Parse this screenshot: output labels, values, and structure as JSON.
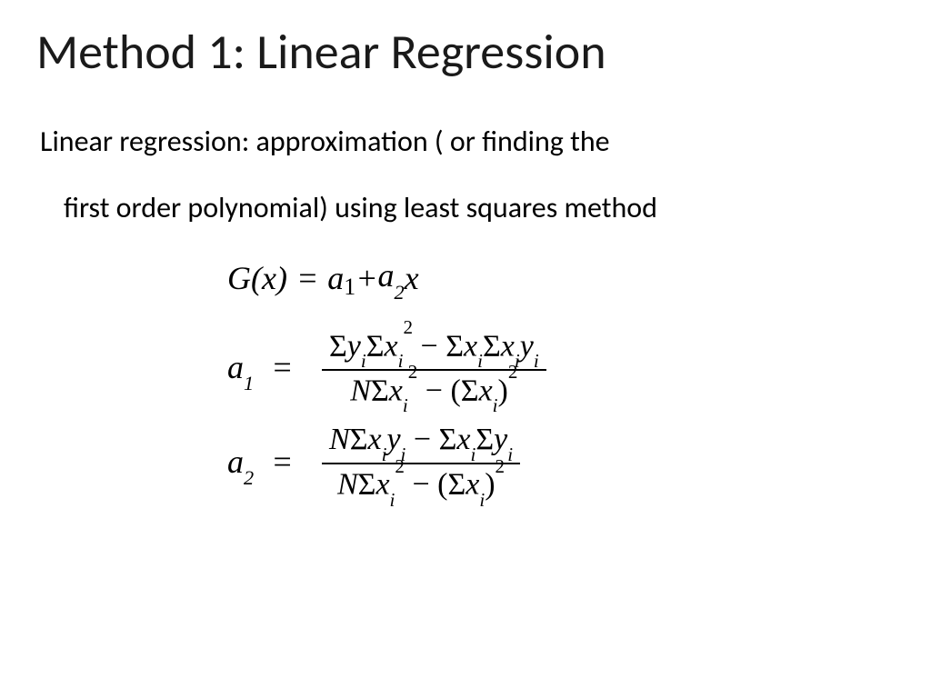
{
  "title": "Method 1: Linear Regression",
  "body": {
    "line1": "Linear regression: approximation ( or finding the",
    "line2": "first order polynomial) using least squares method"
  },
  "equations": {
    "model": {
      "lhs": "G(x)",
      "eq": "=",
      "rhs_a1": "a",
      "rhs_a1_sub": "1",
      "plus": " + ",
      "rhs_a2": "a",
      "rhs_a2_sub": "2",
      "rhs_x": "x"
    },
    "a1": {
      "lhs_var": "a",
      "lhs_sub": "1",
      "eq": "=",
      "num": "Σyᵢ Σxᵢ² − Σxᵢ Σxᵢyᵢ",
      "den": "NΣxᵢ² − (Σxᵢ)²"
    },
    "a2": {
      "lhs_var": "a",
      "lhs_sub": "2",
      "eq": "=",
      "num": "NΣxᵢyᵢ − Σxᵢ Σyᵢ",
      "den": "NΣxᵢ² − (Σxᵢ)²"
    }
  }
}
